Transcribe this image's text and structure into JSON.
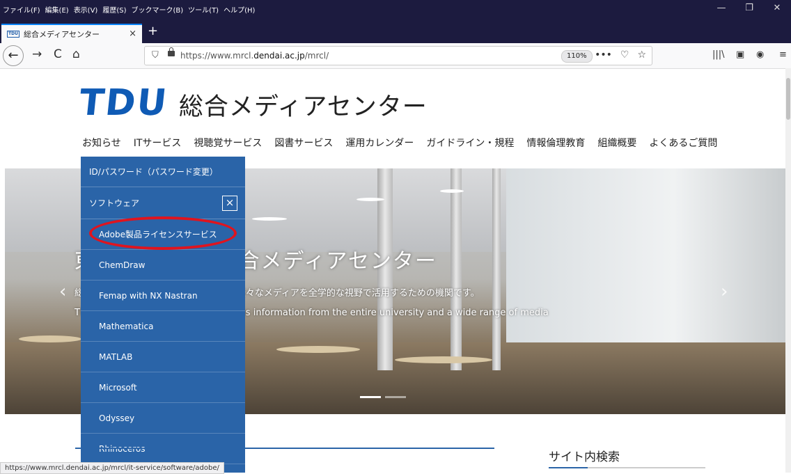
{
  "browser": {
    "menu": [
      "ファイル(F)",
      "編集(E)",
      "表示(V)",
      "履歴(S)",
      "ブックマーク(B)",
      "ツール(T)",
      "ヘルプ(H)"
    ],
    "tab": {
      "favicon": "TDU",
      "title": "総合メディアセンター",
      "close": "×"
    },
    "new_tab": "+",
    "nav": {
      "back": "←",
      "forward": "→",
      "reload": "C",
      "home": "⌂"
    },
    "url_prefix": "https://www.mrcl.",
    "url_domain": "dendai.ac.jp",
    "url_path": "/mrcl/",
    "zoom": "110%",
    "url_icons": [
      "•••",
      "♡",
      "☆"
    ],
    "toolbar_icons": [
      "|||\\",
      "▣",
      "◉",
      "≡"
    ],
    "window_controls": [
      "—",
      "❐",
      "✕"
    ]
  },
  "site": {
    "logo_mark": "TDU",
    "logo_name": "総合メディアセンター",
    "nav": [
      "お知らせ",
      "ITサービス",
      "視聴覚サービス",
      "図書サービス",
      "運用カレンダー",
      "ガイドライン・規程",
      "情報倫理教育",
      "組織概要",
      "よくあるご質問"
    ]
  },
  "hero": {
    "title": "東京電機大学 総合メディアセンター",
    "desc": "総合メディアセンターは、全学の情報や様々なメディアを全学的な視野で活用するための機関です。",
    "desc_en": "The Media Center and Library contains information from the entire university and a wide range of media",
    "prev": "‹",
    "next": "›"
  },
  "dropdown": {
    "top_item": "ID/パスワード（パスワード変更）",
    "section": "ソフトウェア",
    "close": "×",
    "items": [
      "Adobe製品ライセンスサービス",
      "ChemDraw",
      "Femap with NX Nastran",
      "Mathematica",
      "MATLAB",
      "Microsoft",
      "Odyssey",
      "Rhinoceros"
    ]
  },
  "search": {
    "heading": "サイト内検索"
  },
  "status": {
    "url": "https://www.mrcl.dendai.ac.jp/mrcl/it-service/software/adobe/"
  },
  "colors": {
    "brand": "#0f5bb5",
    "dropdown": "#2a64a8",
    "highlight": "#e0141e"
  }
}
